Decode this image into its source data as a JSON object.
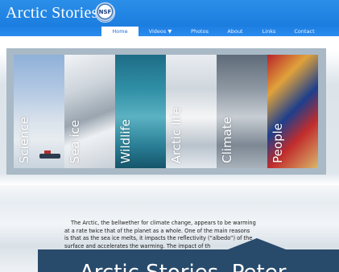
{
  "site": {
    "title": "Arctic Stories",
    "logo_text": "NSF"
  },
  "nav": {
    "items": [
      {
        "label": "Home",
        "active": true
      },
      {
        "label": "Videos ▼"
      },
      {
        "label": "Photos"
      },
      {
        "label": "About"
      },
      {
        "label": "Links"
      },
      {
        "label": "Contact"
      }
    ]
  },
  "panels": [
    {
      "label": "Science"
    },
    {
      "label": "Sea ice"
    },
    {
      "label": "Wildlife"
    },
    {
      "label": "Arctic life"
    },
    {
      "label": "Climate"
    },
    {
      "label": "People"
    }
  ],
  "intro": {
    "line1": "The Arctic, the bellwether for climate change, appears to be warming",
    "line2": "at a rate twice that of the planet as a whole. One of the main reasons",
    "line3": "is that as the sea ice melts, it impacts the reflectivity (“albedo”) of the",
    "line4": "surface and accelerates the warming. The impact of th"
  },
  "banner": {
    "text": "Arctic Stories, Peter"
  },
  "colors": {
    "header": "#1b7ddf",
    "banner": "#284a6b",
    "panel_frame": "#a9b9c6"
  }
}
